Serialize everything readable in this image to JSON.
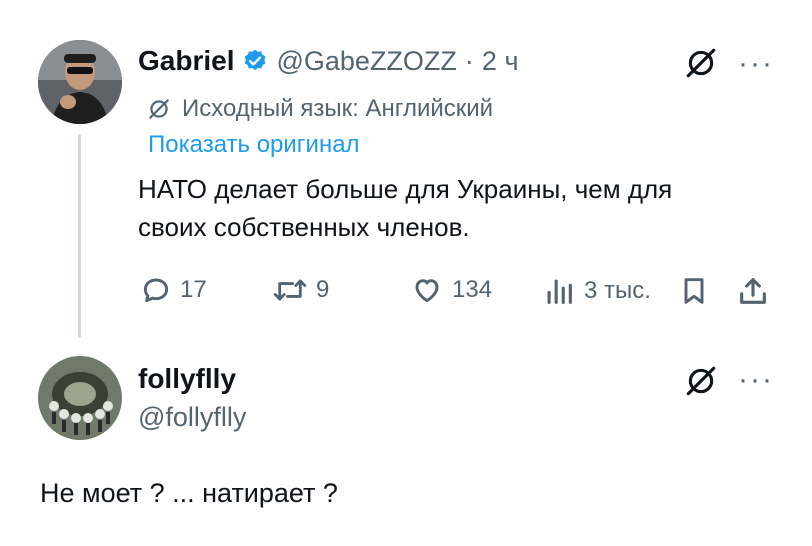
{
  "post": {
    "author_name": "Gabriel",
    "author_handle": "@GabeZZOZZ",
    "separator": "·",
    "time": "2 ч",
    "translation_note": "Исходный язык: Английский",
    "show_original": "Показать оригинал",
    "text_line1": "НАТО делает больше для Украины, чем для",
    "text_line2": "своих собственных членов.",
    "stats": {
      "replies": "17",
      "reposts": "9",
      "likes": "134",
      "views": "3 тыс."
    }
  },
  "reply": {
    "author_name": "follyflly",
    "author_handle": "@follyflly",
    "text": "Не моет ? ... натирает ?"
  },
  "menu_label": "···",
  "colors": {
    "accent": "#1d9bf0",
    "muted": "#536471",
    "text": "#0f1419",
    "thread_line": "#cfd9de"
  },
  "icons": [
    "verified-badge-icon",
    "translate-icon",
    "more-icon",
    "reply-icon",
    "repost-icon",
    "like-icon",
    "views-icon",
    "bookmark-icon",
    "share-icon"
  ]
}
